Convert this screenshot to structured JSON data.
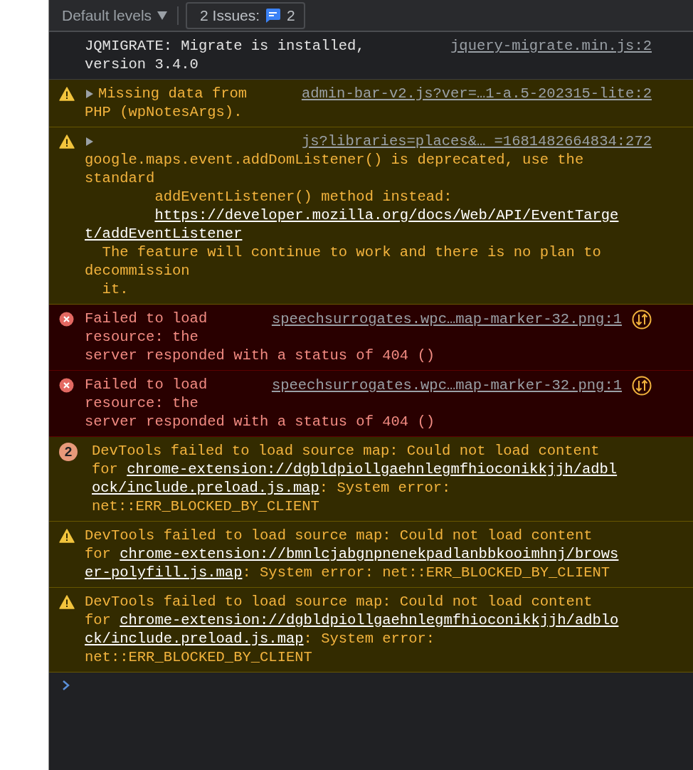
{
  "toolbar": {
    "levels": {
      "label": "Default levels"
    },
    "issues": {
      "label": "2 Issues:",
      "count": "2"
    }
  },
  "messages": [
    {
      "kind": "info",
      "source": "jquery-migrate.min.js:2",
      "head": [
        {
          "kind": "plain",
          "parts": [
            {
              "kind": "text",
              "text": "JQMIGRATE: Migrate is installed,"
            }
          ]
        },
        {
          "kind": "plain",
          "parts": [
            {
              "kind": "text",
              "text": "version 3.4.0"
            }
          ]
        }
      ]
    },
    {
      "kind": "warning",
      "expanded": false,
      "source": "admin-bar-v2.js?ver=…1-a.5-202315-lite:2",
      "head": [
        {
          "kind": "plain",
          "parts": [
            {
              "kind": "text",
              "text": "Missing data from"
            }
          ]
        },
        {
          "kind": "plain",
          "parts": [
            {
              "kind": "text",
              "text": "PHP (wpNotesArgs)."
            }
          ]
        }
      ]
    },
    {
      "kind": "warning",
      "expanded": false,
      "source": "js?libraries=places&… =1681482664834:272",
      "lines": [
        {
          "kind": "plain",
          "parts": [
            {
              "kind": "text",
              "text": "google.maps.event.addDomListener() is deprecated, use the"
            }
          ]
        },
        {
          "kind": "plain",
          "parts": [
            {
              "kind": "text",
              "text": "standard"
            }
          ]
        },
        {
          "kind": "tab",
          "parts": [
            {
              "kind": "text",
              "text": "addEventListener() method instead:"
            }
          ]
        },
        {
          "kind": "tab",
          "parts": [
            {
              "kind": "link",
              "text": "https://developer.mozilla.org/docs/Web/API/EventTarge"
            }
          ]
        },
        {
          "kind": "plain",
          "parts": [
            {
              "kind": "link",
              "text": "t/addEventListener"
            }
          ]
        },
        {
          "kind": "space",
          "parts": [
            {
              "kind": "text",
              "text": "The feature will continue to work and there is no plan to"
            }
          ]
        },
        {
          "kind": "plain",
          "parts": [
            {
              "kind": "text",
              "text": "decommission"
            }
          ]
        },
        {
          "kind": "space",
          "parts": [
            {
              "kind": "text",
              "text": "it."
            }
          ]
        }
      ]
    },
    {
      "kind": "error",
      "network": true,
      "source": "speechsurrogates.wpc…map-marker-32.png:1",
      "head": [
        {
          "kind": "plain",
          "parts": [
            {
              "kind": "text",
              "text": "Failed to load"
            }
          ]
        },
        {
          "kind": "plain",
          "parts": [
            {
              "kind": "text",
              "text": "resource: the"
            }
          ]
        }
      ],
      "lines": [
        {
          "kind": "plain",
          "parts": [
            {
              "kind": "text",
              "text": "server responded with a status of 404 ()"
            }
          ]
        }
      ]
    },
    {
      "kind": "error",
      "network": true,
      "source": "speechsurrogates.wpc…map-marker-32.png:1",
      "head": [
        {
          "kind": "plain",
          "parts": [
            {
              "kind": "text",
              "text": "Failed to load"
            }
          ]
        },
        {
          "kind": "plain",
          "parts": [
            {
              "kind": "text",
              "text": "resource: the"
            }
          ]
        }
      ],
      "lines": [
        {
          "kind": "plain",
          "parts": [
            {
              "kind": "text",
              "text": "server responded with a status of 404 ()"
            }
          ]
        }
      ]
    },
    {
      "kind": "warning",
      "count": "2",
      "lines": [
        {
          "kind": "plain",
          "parts": [
            {
              "kind": "text",
              "text": "DevTools failed to load source map: Could not load content"
            }
          ]
        },
        {
          "kind": "plain",
          "parts": [
            {
              "kind": "text",
              "text": "for"
            },
            {
              "kind": "link",
              "text": "chrome-extension://dgbldpiollgaehnlegmfhioconikkjjh/adbl"
            }
          ]
        },
        {
          "kind": "plain",
          "parts": [
            {
              "kind": "link",
              "text": "ock/include.preload.js.map"
            },
            {
              "kind": "text",
              "text": ": System error:"
            }
          ]
        },
        {
          "kind": "plain",
          "parts": [
            {
              "kind": "text",
              "text": "net::ERR_BLOCKED_BY_CLIENT"
            }
          ]
        }
      ]
    },
    {
      "kind": "warning",
      "lines": [
        {
          "kind": "plain",
          "parts": [
            {
              "kind": "text",
              "text": "DevTools failed to load source map: Could not load content"
            }
          ]
        },
        {
          "kind": "plain",
          "parts": [
            {
              "kind": "text",
              "text": "for"
            },
            {
              "kind": "link",
              "text": "chrome-extension://bmnlcjabgnpnenekpadlanbbkooimhnj/brows"
            }
          ]
        },
        {
          "kind": "plain",
          "parts": [
            {
              "kind": "link",
              "text": "er-polyfill.js.map"
            },
            {
              "kind": "text",
              "text": ": System error: net::ERR_BLOCKED_BY_CLIENT"
            }
          ]
        }
      ]
    },
    {
      "kind": "warning",
      "lines": [
        {
          "kind": "plain",
          "parts": [
            {
              "kind": "text",
              "text": "DevTools failed to load source map: Could not load content"
            }
          ]
        },
        {
          "kind": "plain",
          "parts": [
            {
              "kind": "text",
              "text": "for"
            },
            {
              "kind": "link",
              "text": "chrome-extension://dgbldpiollgaehnlegmfhioconikkjjh/adblo"
            }
          ]
        },
        {
          "kind": "plain",
          "parts": [
            {
              "kind": "link",
              "text": "ck/include.preload.js.map"
            },
            {
              "kind": "text",
              "text": ": System error:"
            }
          ]
        },
        {
          "kind": "plain",
          "parts": [
            {
              "kind": "text",
              "text": "net::ERR_BLOCKED_BY_CLIENT"
            }
          ]
        }
      ]
    }
  ]
}
